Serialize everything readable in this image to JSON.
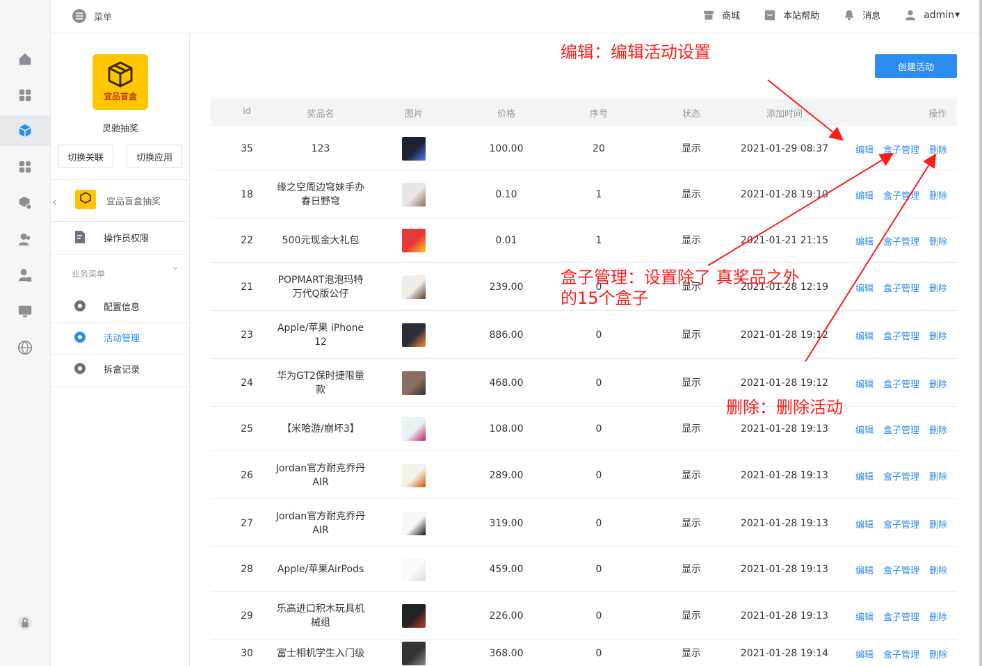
{
  "topbar": {
    "menu_label": "菜单",
    "links": [
      "商城",
      "本站帮助",
      "消息"
    ],
    "user": "admin"
  },
  "app": {
    "logo_text": "宜品盲盒",
    "name": "灵驰抽奖",
    "switch_link": "切换关联",
    "switch_app": "切换应用",
    "current_app": "宜品盲盒抽奖"
  },
  "sidebar": {
    "operator": "操作员权限",
    "group": "业务菜单",
    "items": [
      "配置信息",
      "活动管理",
      "拆盒记录"
    ]
  },
  "main": {
    "create_button": "创建活动",
    "columns": [
      "id",
      "奖品名",
      "图片",
      "价格",
      "序号",
      "状态",
      "添加时间",
      "操作"
    ],
    "actions": {
      "edit": "编辑",
      "box": "盒子管理",
      "delete": "删除"
    },
    "rows": [
      {
        "id": "35",
        "name": "123",
        "price": "100.00",
        "seq": "20",
        "status": "显示",
        "time": "2021-01-29 08:37"
      },
      {
        "id": "18",
        "name": "缘之空周边穹妹手办\n春日野穹",
        "price": "0.10",
        "seq": "1",
        "status": "显示",
        "time": "2021-01-28 19:10"
      },
      {
        "id": "22",
        "name": "500元现金大礼包",
        "price": "0.01",
        "seq": "1",
        "status": "显示",
        "time": "2021-01-21 21:15"
      },
      {
        "id": "21",
        "name": "POPMART泡泡玛特\n万代Q版公仔",
        "price": "239.00",
        "seq": "0",
        "status": "显示",
        "time": "2021-01-28 12:19"
      },
      {
        "id": "23",
        "name": "Apple/苹果 iPhone\n12",
        "price": "886.00",
        "seq": "0",
        "status": "显示",
        "time": "2021-01-28 19:12"
      },
      {
        "id": "24",
        "name": "华为GT2保时捷限量\n款",
        "price": "468.00",
        "seq": "0",
        "status": "显示",
        "time": "2021-01-28 19:12"
      },
      {
        "id": "25",
        "name": "【米哈游/崩坏3】",
        "price": "108.00",
        "seq": "0",
        "status": "显示",
        "time": "2021-01-28 19:13"
      },
      {
        "id": "26",
        "name": "Jordan官方耐克乔丹\nAIR",
        "price": "289.00",
        "seq": "0",
        "status": "显示",
        "time": "2021-01-28 19:13"
      },
      {
        "id": "27",
        "name": "Jordan官方耐克乔丹\nAIR",
        "price": "319.00",
        "seq": "0",
        "status": "显示",
        "time": "2021-01-28 19:13"
      },
      {
        "id": "28",
        "name": "Apple/苹果AirPods",
        "price": "459.00",
        "seq": "0",
        "status": "显示",
        "time": "2021-01-28 19:13"
      },
      {
        "id": "29",
        "name": "乐高进口积木玩具机\n械组",
        "price": "226.00",
        "seq": "0",
        "status": "显示",
        "time": "2021-01-28 19:13"
      },
      {
        "id": "30",
        "name": "富士相机学生入门级",
        "price": "368.00",
        "seq": "0",
        "status": "显示",
        "time": "2021-01-28 19:14"
      }
    ]
  },
  "annotations": {
    "edit": "编辑：编辑活动设置",
    "box": "盒子管理：设置除了 真奖品之外\n的15个盒子",
    "delete": "删除：删除活动"
  },
  "colors": {
    "accent": "#2d8cf0",
    "annotation": "#ff1a1a",
    "logo": "#ffc600"
  }
}
